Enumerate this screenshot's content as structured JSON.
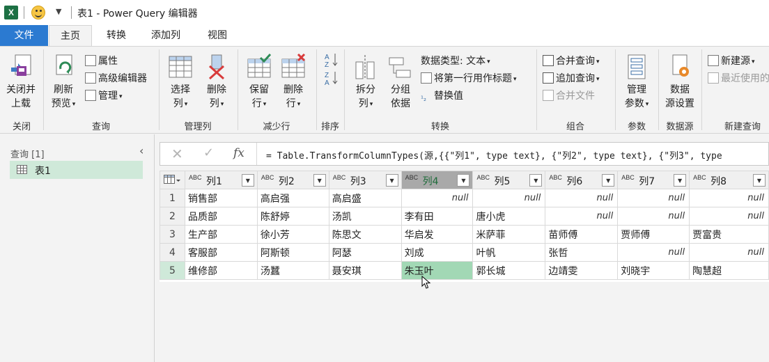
{
  "window": {
    "app_logo": "X",
    "title": "表1 - Power Query 编辑器"
  },
  "tabs": [
    "文件",
    "主页",
    "转换",
    "添加列",
    "视图"
  ],
  "ribbon": {
    "close": {
      "btn": "关闭并\n上载",
      "group": "关闭"
    },
    "query": {
      "refresh": "刷新\n预览",
      "properties": "属性",
      "advanced_editor": "高级编辑器",
      "manage": "管理",
      "group": "查询"
    },
    "manage_columns": {
      "choose": "选择\n列",
      "remove": "删除\n列",
      "group": "管理列"
    },
    "reduce_rows": {
      "keep": "保留\n行",
      "remove": "删除\n行",
      "group": "减少行"
    },
    "sort": {
      "group": "排序"
    },
    "transform": {
      "split": "拆分\n列",
      "group_by": "分组\n依据",
      "data_type": "数据类型: 文本",
      "first_row_header": "将第一行用作标题",
      "replace": "替换值",
      "group": "转换"
    },
    "combine": {
      "merge": "合并查询",
      "append": "追加查询",
      "combine_files": "合并文件",
      "group": "组合"
    },
    "parameters": {
      "manage": "管理\n参数",
      "group": "参数"
    },
    "data_source": {
      "settings": "数据\n源设置",
      "group": "数据源"
    },
    "new_query": {
      "new_source": "新建源",
      "recent": "最近使用的",
      "group": "新建查询"
    }
  },
  "left_pane": {
    "title": "查询 [1]",
    "items": [
      "表1"
    ]
  },
  "formula_bar": {
    "fx": "fx",
    "formula": "= Table.TransformColumnTypes(源,{{\"列1\", type text}, {\"列2\", type text}, {\"列3\", type"
  },
  "grid": {
    "type_label": "ABC",
    "columns": [
      "列1",
      "列2",
      "列3",
      "列4",
      "列5",
      "列6",
      "列7",
      "列8"
    ],
    "selected_column": 3,
    "selected_row": 4,
    "rows": [
      [
        "1",
        "销售部",
        "高启强",
        "高启盛",
        "null",
        "null",
        "null",
        "null",
        "null"
      ],
      [
        "2",
        "品质部",
        "陈舒婷",
        "汤凯",
        "李有田",
        "唐小虎",
        "null",
        "null",
        "null"
      ],
      [
        "3",
        "生产部",
        "徐小芳",
        "陈思文",
        "华启发",
        "米萨菲",
        "苗师傅",
        "贾师傅",
        "贾富贵"
      ],
      [
        "4",
        "客服部",
        "阿斯顿",
        "阿瑟",
        "刘成",
        "叶帆",
        "张哲",
        "null",
        "null"
      ],
      [
        "5",
        "维修部",
        "汤蠶",
        "聂安琪",
        "朱玉叶",
        "郭长城",
        "边靖雯",
        "刘晓宇",
        "陶慧超"
      ]
    ]
  }
}
